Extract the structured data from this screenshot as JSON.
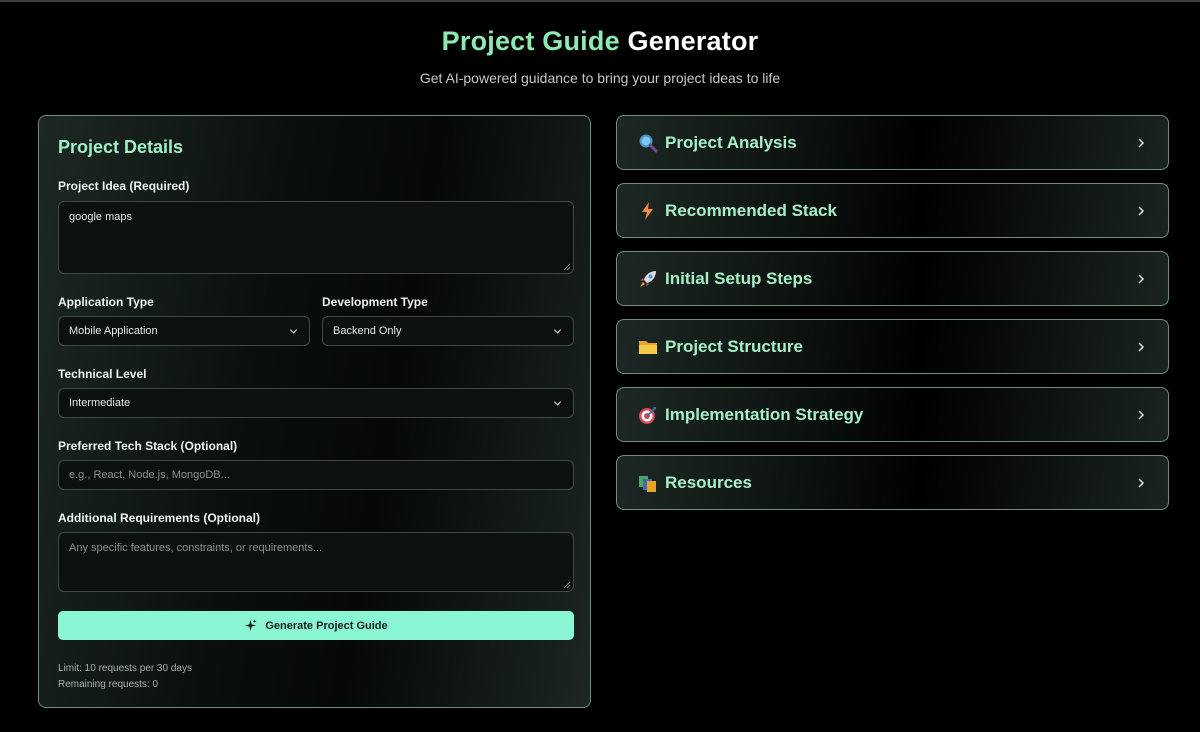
{
  "header": {
    "title_part1": "Project Guide",
    "title_part2": "Generator",
    "subtitle": "Get AI-powered guidance to bring your project ideas to life"
  },
  "form": {
    "title": "Project Details",
    "project_idea": {
      "label": "Project Idea (Required)",
      "value": "google maps"
    },
    "application_type": {
      "label": "Application Type",
      "selected": "Mobile Application"
    },
    "development_type": {
      "label": "Development Type",
      "selected": "Backend Only"
    },
    "technical_level": {
      "label": "Technical Level",
      "selected": "Intermediate"
    },
    "tech_stack": {
      "label": "Preferred Tech Stack (Optional)",
      "placeholder": "e.g., React, Node.js, MongoDB..."
    },
    "requirements": {
      "label": "Additional Requirements (Optional)",
      "placeholder": "Any specific features, constraints, or requirements..."
    },
    "generate_button": {
      "label": "Generate Project Guide",
      "icon": "sparkles-icon",
      "color": "#8af6d6"
    },
    "limit_text": "Limit: 10 requests per 30 days",
    "remaining_text": "Remaining requests: 0"
  },
  "sections": [
    {
      "label": "Project Analysis",
      "icon": "magnifier-icon"
    },
    {
      "label": "Recommended Stack",
      "icon": "lightning-icon"
    },
    {
      "label": "Initial Setup Steps",
      "icon": "rocket-icon"
    },
    {
      "label": "Project Structure",
      "icon": "folder-icon"
    },
    {
      "label": "Implementation Strategy",
      "icon": "target-icon"
    },
    {
      "label": "Resources",
      "icon": "books-icon"
    }
  ],
  "colors": {
    "accent": "#8eeab2",
    "section_text": "#a6f0c8",
    "border": "#6e8f7e",
    "background": "#000000"
  }
}
